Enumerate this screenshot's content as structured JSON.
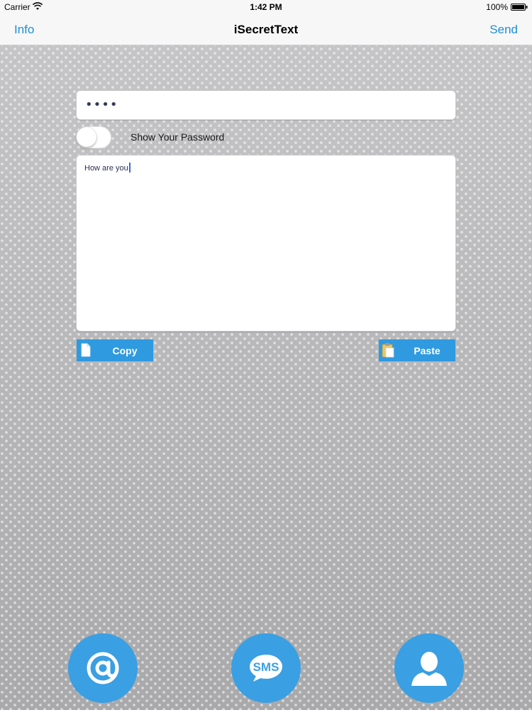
{
  "status_bar": {
    "carrier": "Carrier",
    "time": "1:42 PM",
    "battery": "100%"
  },
  "nav_bar": {
    "left_label": "Info",
    "title": "iSecretText",
    "right_label": "Send"
  },
  "password": {
    "masked_value": "••••",
    "show_password_label": "Show Your Password",
    "show_password_on": false
  },
  "message": {
    "text": "How are you"
  },
  "actions": {
    "copy_label": "Copy",
    "paste_label": "Paste"
  },
  "share_buttons": {
    "email_icon": "at-sign-icon",
    "sms_label": "SMS",
    "contacts_icon": "person-icon"
  },
  "colors": {
    "accent": "#1d8fd6",
    "button_blue": "#2f9ae0",
    "circle_blue": "#3a9fe3"
  }
}
